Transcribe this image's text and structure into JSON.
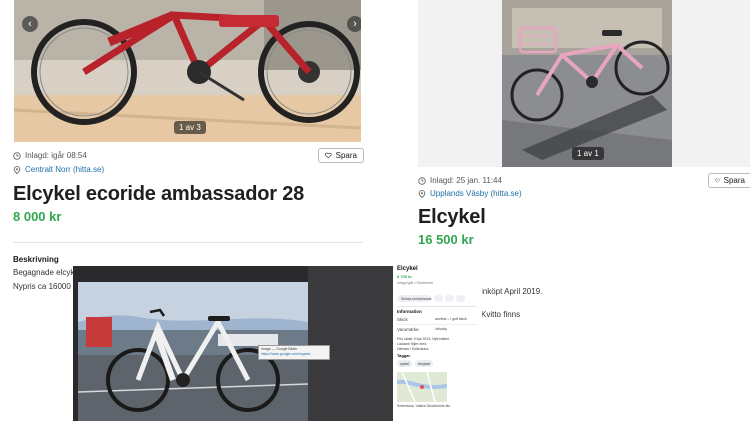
{
  "ad_left": {
    "counter": "1 av 3",
    "posted": "Inlagd: igår 08:54",
    "location": "Centralt Norr (hitta.se)",
    "save_label": "Spara",
    "title": "Elcykel ecoride ambassador 28",
    "price": "8 000 kr",
    "description_heading": "Beskrivning",
    "description_lines": [
      "Begagnade elcyk",
      "Nypris ca 16000"
    ]
  },
  "ad_right": {
    "counter": "1 av 1",
    "posted": "Inlagd: 25 jan. 11:44",
    "location": "Upplands Väsby (hitta.se)",
    "save_label": "Spara",
    "title": "Elcykel",
    "price": "16 500 kr",
    "description_fragments": [
      "inköpt April 2019.",
      "Kvitto finns"
    ]
  },
  "overlay_tooltip": {
    "line1": "Image — Google Bilder",
    "line2": "https://www.google.com/imgres/..."
  },
  "mini_ad": {
    "title": "Elcykel",
    "price": "8 700 kr",
    "meta": "Inlagd igår • Stockholm",
    "action_label": "Skicka meddelande",
    "info_heading": "Information",
    "info_rows": [
      {
        "label": "Skick",
        "value": "använd – i gott skick"
      },
      {
        "label": "Varumärke",
        "value": "Velocity"
      }
    ],
    "body_lines": [
      "Pris sänkt. Köpt 2019. Nytt batteri.",
      "Laddare följer med.",
      "Hämtas i Sollentuna."
    ],
    "tags_heading": "Taggar",
    "tags": [
      "cykel",
      "elcykel"
    ],
    "location_line": "Sollentuna, Västra Stockholms län"
  },
  "colors": {
    "price_green": "#2fa84f",
    "link_blue": "#1d6fa5",
    "bike_red": "#b8222a",
    "bike_pink": "#e7a6bf"
  }
}
